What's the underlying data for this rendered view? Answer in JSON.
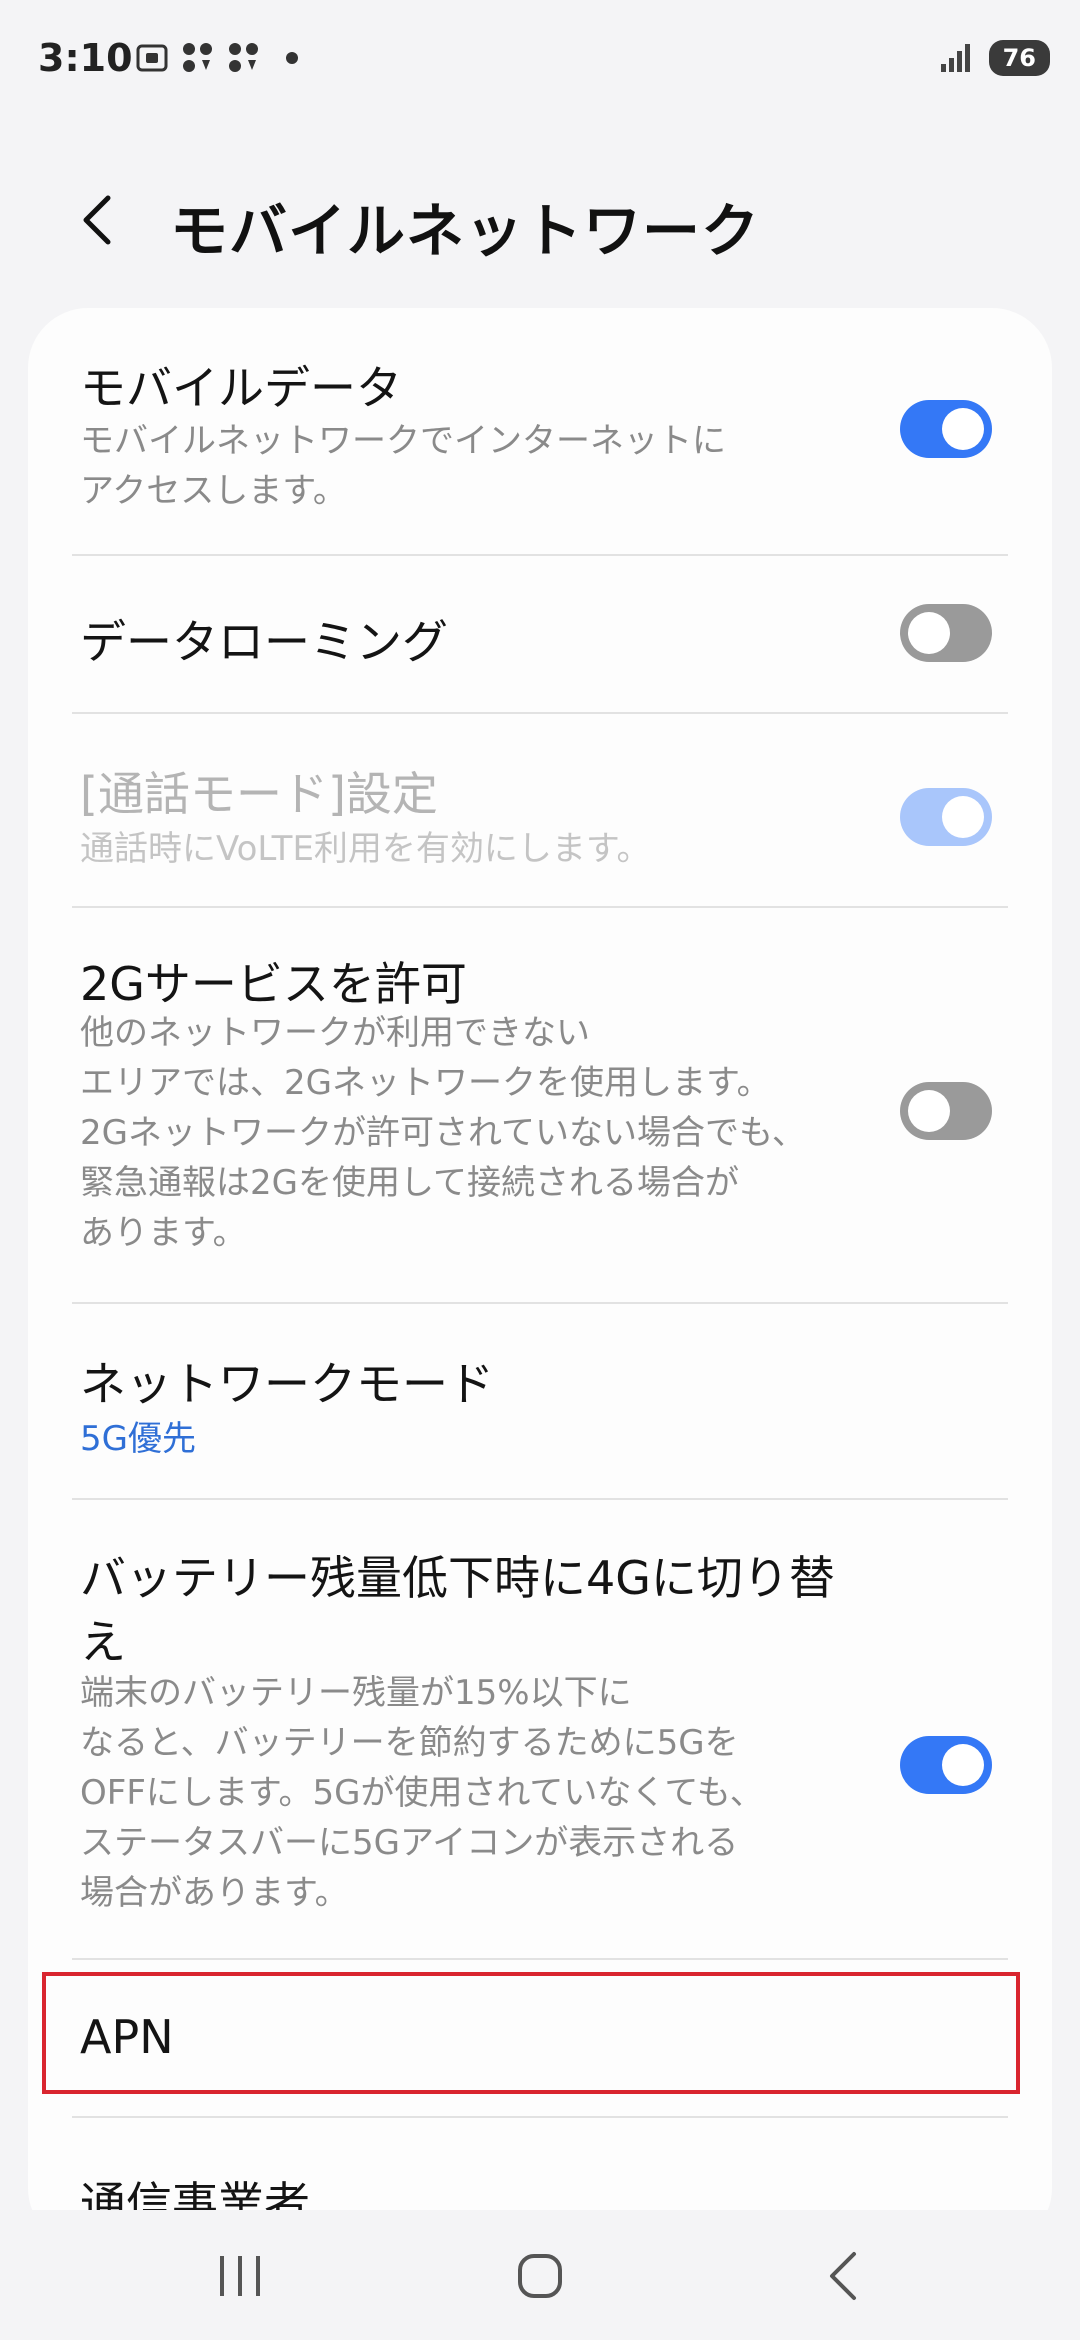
{
  "status_bar": {
    "time": "3:10",
    "battery": "76",
    "icons": [
      "screenshot-icon",
      "dots-download-icon",
      "dots-download-icon",
      "notification-dot-icon",
      "signal-icon",
      "battery-icon"
    ]
  },
  "header": {
    "title": "モバイルネットワーク",
    "back_icon": "chevron-left-icon"
  },
  "settings": [
    {
      "title": "モバイルデータ",
      "subtitle_lines": [
        "モバイルネットワークでインターネットに",
        "アクセスします。"
      ],
      "toggle": "on"
    },
    {
      "title": "データローミング",
      "subtitle_lines": [],
      "toggle": "off"
    },
    {
      "title": "[通話モード]設定",
      "subtitle_lines": [
        "通話時にVoLTE利用を有効にします。"
      ],
      "toggle": "on",
      "disabled": true
    },
    {
      "title": "2Gサービスを許可",
      "subtitle_lines": [
        "他のネットワークが利用できない",
        "エリアでは、2Gネットワークを使用します。",
        "2Gネットワークが許可されていない場合でも、",
        "緊急通報は2Gを使用して接続される場合が",
        "あります。"
      ],
      "toggle": "off"
    },
    {
      "title": "ネットワークモード",
      "value": "5G優先"
    },
    {
      "title_lines": [
        "バッテリー残量低下時に4Gに切り替",
        "え"
      ],
      "subtitle_lines": [
        "端末のバッテリー残量が15%以下に",
        "なると、バッテリーを節約するために5Gを",
        "OFFにします。5Gが使用されていなくても、",
        "ステータスバーに5Gアイコンが表示される",
        "場合があります。"
      ],
      "toggle": "on"
    },
    {
      "title": "APN"
    },
    {
      "title": "通信事業者"
    }
  ],
  "colors": {
    "accent": "#3478f6",
    "highlight": "#d9252f",
    "link_value": "#2f6fd6"
  },
  "nav_bar": {
    "icons": [
      "recent-apps-icon",
      "home-icon",
      "back-icon"
    ]
  }
}
